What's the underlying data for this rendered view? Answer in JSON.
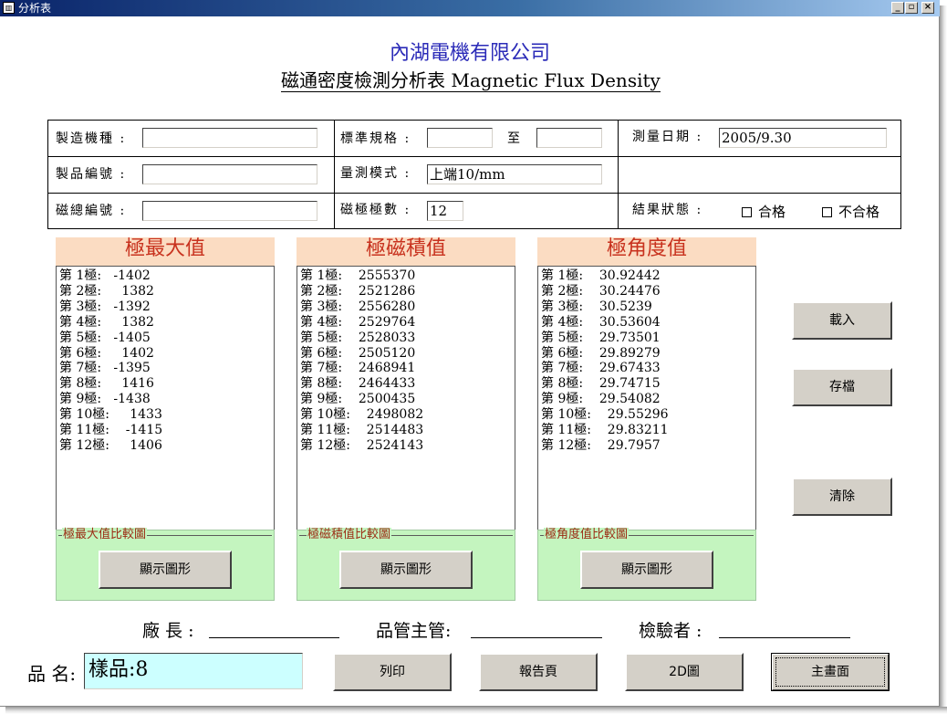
{
  "window": {
    "title": "分析表",
    "icon": "chart-icon"
  },
  "header": {
    "company": "內湖電機有限公司",
    "subtitle": "磁通密度檢測分析表   Magnetic Flux Density"
  },
  "info": {
    "model_label": "製造機種 :",
    "model_value": "",
    "spec_label": "標準規格 :",
    "spec_from": "",
    "spec_to_label": "至",
    "spec_to": "",
    "date_label": "測量日期 :",
    "date_value": "2005/9.30",
    "product_no_label": "製品編號 :",
    "product_no_value": "",
    "mode_label": "量測模式 :",
    "mode_value": "上端10/mm",
    "magnet_no_label": "磁總編號 :",
    "magnet_no_value": "",
    "poles_label": "磁極極數 :",
    "poles_value": "12",
    "result_label": "結果狀態 :",
    "pass_label": "合格",
    "fail_label": "不合格"
  },
  "panels": [
    {
      "title": "極最大值",
      "rows": [
        "第 1極:   -1402",
        "第 2極:     1382",
        "第 3極:   -1392",
        "第 4極:     1382",
        "第 5極:   -1405",
        "第 6極:     1402",
        "第 7極:   -1395",
        "第 8極:     1416",
        "第 9極:   -1438",
        "第 10極:     1433",
        "第 11極:    -1415",
        "第 12極:     1406"
      ],
      "group_title": "極最大值比較圖",
      "button": "顯示圖形"
    },
    {
      "title": "極磁積值",
      "rows": [
        "第 1極:    2555370",
        "第 2極:    2521286",
        "第 3極:    2556280",
        "第 4極:    2529764",
        "第 5極:    2528033",
        "第 6極:    2505120",
        "第 7極:    2468941",
        "第 8極:    2464433",
        "第 9極:    2500435",
        "第 10極:    2498082",
        "第 11極:    2514483",
        "第 12極:    2524143"
      ],
      "group_title": "極磁積值比較圖",
      "button": "顯示圖形"
    },
    {
      "title": "極角度值",
      "rows": [
        "第 1極:    30.92442",
        "第 2極:    30.24476",
        "第 3極:    30.5239",
        "第 4極:    30.53604",
        "第 5極:    29.73501",
        "第 6極:    29.89279",
        "第 7極:    29.67433",
        "第 8極:    29.74715",
        "第 9極:    29.54082",
        "第 10極:    29.55296",
        "第 11極:    29.83211",
        "第 12極:    29.7957"
      ],
      "group_title": "極角度值比較圖",
      "button": "顯示圖形"
    }
  ],
  "side_buttons": {
    "load": "載入",
    "save": "存檔",
    "clear": "清除"
  },
  "signatures": {
    "factory_manager": "廠 長 :",
    "qc_supervisor": "品管主管:",
    "inspector": "檢驗者 :"
  },
  "product_name": {
    "label": "品 名:",
    "value": "樣品:8"
  },
  "bottom_buttons": {
    "print": "列印",
    "report": "報告頁",
    "chart2d": "2D圖",
    "main": "主畫面"
  }
}
